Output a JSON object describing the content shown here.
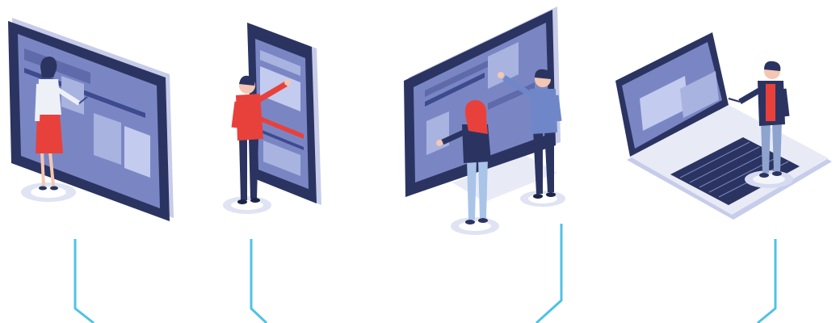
{
  "scene": {
    "background": "#ffffff",
    "devices": [
      {
        "kind": "tablet-landscape",
        "people": [
          "woman-red-skirt"
        ]
      },
      {
        "kind": "smartphone",
        "people": [
          "man-red-shirt"
        ]
      },
      {
        "kind": "desktop-monitor",
        "people": [
          "woman-red-hair",
          "man-blue-shirt"
        ]
      },
      {
        "kind": "laptop",
        "people": [
          "man-black-jacket"
        ]
      }
    ],
    "colors": {
      "device_frame": "#2b3461",
      "screen": "#7a86c4",
      "screen_panel": "#a9b3e0",
      "accent_red": "#e8413c",
      "platform": "#dfe3f3",
      "connector": "#4fc2e6"
    }
  }
}
